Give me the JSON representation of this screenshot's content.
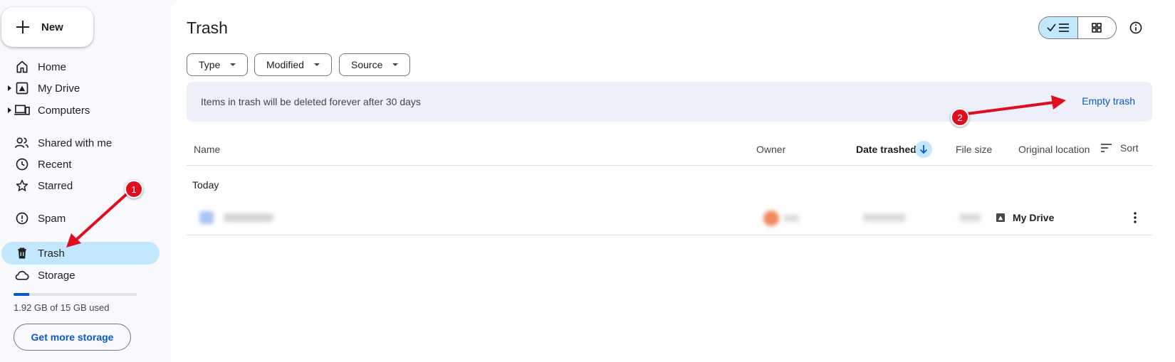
{
  "sidebar": {
    "new_label": "New",
    "items": [
      {
        "label": "Home",
        "icon": "home-icon"
      },
      {
        "label": "My Drive",
        "icon": "drive-icon"
      },
      {
        "label": "Computers",
        "icon": "computers-icon"
      },
      {
        "label": "Shared with me",
        "icon": "people-icon"
      },
      {
        "label": "Recent",
        "icon": "clock-icon"
      },
      {
        "label": "Starred",
        "icon": "star-icon"
      },
      {
        "label": "Spam",
        "icon": "spam-icon"
      },
      {
        "label": "Trash",
        "icon": "trash-icon"
      },
      {
        "label": "Storage",
        "icon": "cloud-icon"
      }
    ],
    "storage": {
      "used_text": "1.92 GB of 15 GB used",
      "fraction": 0.128,
      "button_label": "Get more storage"
    }
  },
  "main": {
    "title": "Trash",
    "filters": [
      "Type",
      "Modified",
      "Source"
    ],
    "banner": {
      "text": "Items in trash will be deleted forever after 30 days",
      "action": "Empty trash"
    },
    "columns": {
      "name": "Name",
      "owner": "Owner",
      "date_trashed": "Date trashed",
      "file_size": "File size",
      "original_location": "Original location",
      "sort": "Sort"
    },
    "group_label": "Today",
    "rows": [
      {
        "original_location": "My Drive"
      }
    ]
  },
  "annotations": {
    "badge_1": "1",
    "badge_2": "2"
  },
  "colors": {
    "accent": "#0b57d0",
    "active_bg": "#c2e7ff",
    "banner_bg": "#edf0f8",
    "annotation": "#e10d1f"
  }
}
